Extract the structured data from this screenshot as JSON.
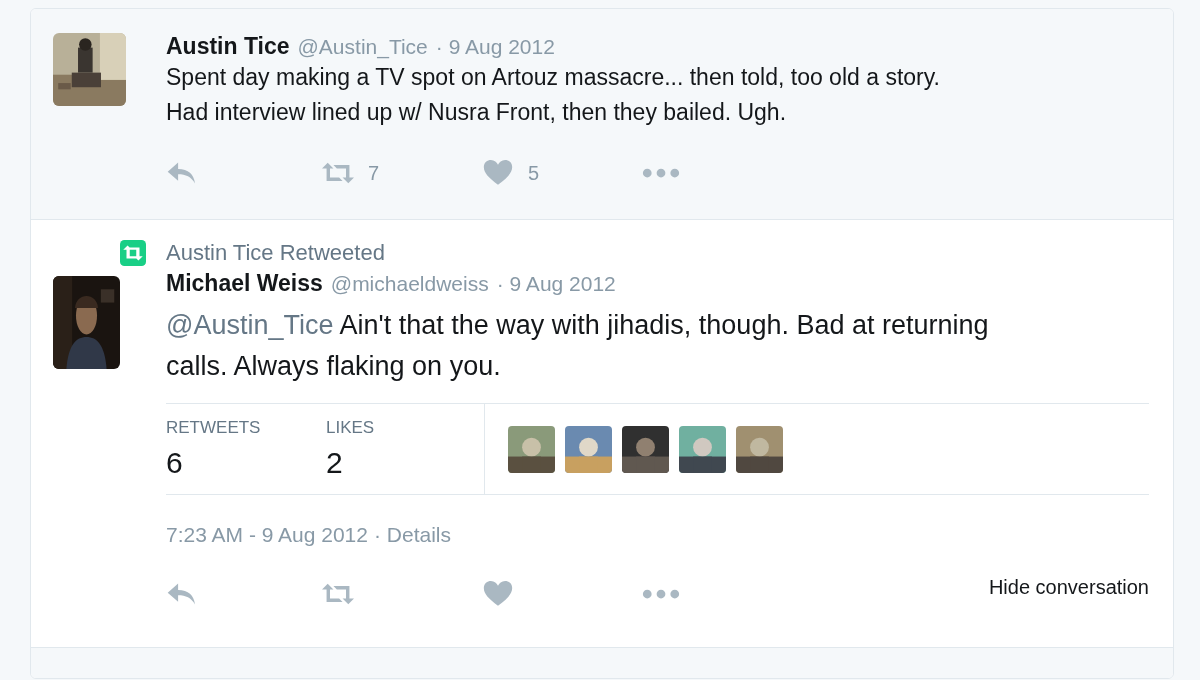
{
  "parent_tweet": {
    "name": "Austin Tice",
    "handle": "@Austin_Tice",
    "date": "· 9 Aug 2012",
    "text": "Spent day making a TV spot on Artouz massacre... then told, too old a story.\nHad interview lined up w/ Nusra Front, then they bailed. Ugh.",
    "retweet_count": "7",
    "like_count": "5"
  },
  "focused_tweet": {
    "context": "Austin Tice Retweeted",
    "name": "Michael Weiss",
    "handle": "@michaeldweiss",
    "date": "· 9 Aug 2012",
    "mention": "@Austin_Tice",
    "text": " Ain't that the way with jihadis, though. Bad at returning\ncalls. Always flaking on you.",
    "stats": [
      {
        "label": "RETWEETS",
        "value": "6"
      },
      {
        "label": "LIKES",
        "value": "2"
      }
    ],
    "timestamp": "7:23 AM - 9 Aug 2012",
    "details_link": "· Details",
    "hide_conversation": "Hide conversation"
  }
}
